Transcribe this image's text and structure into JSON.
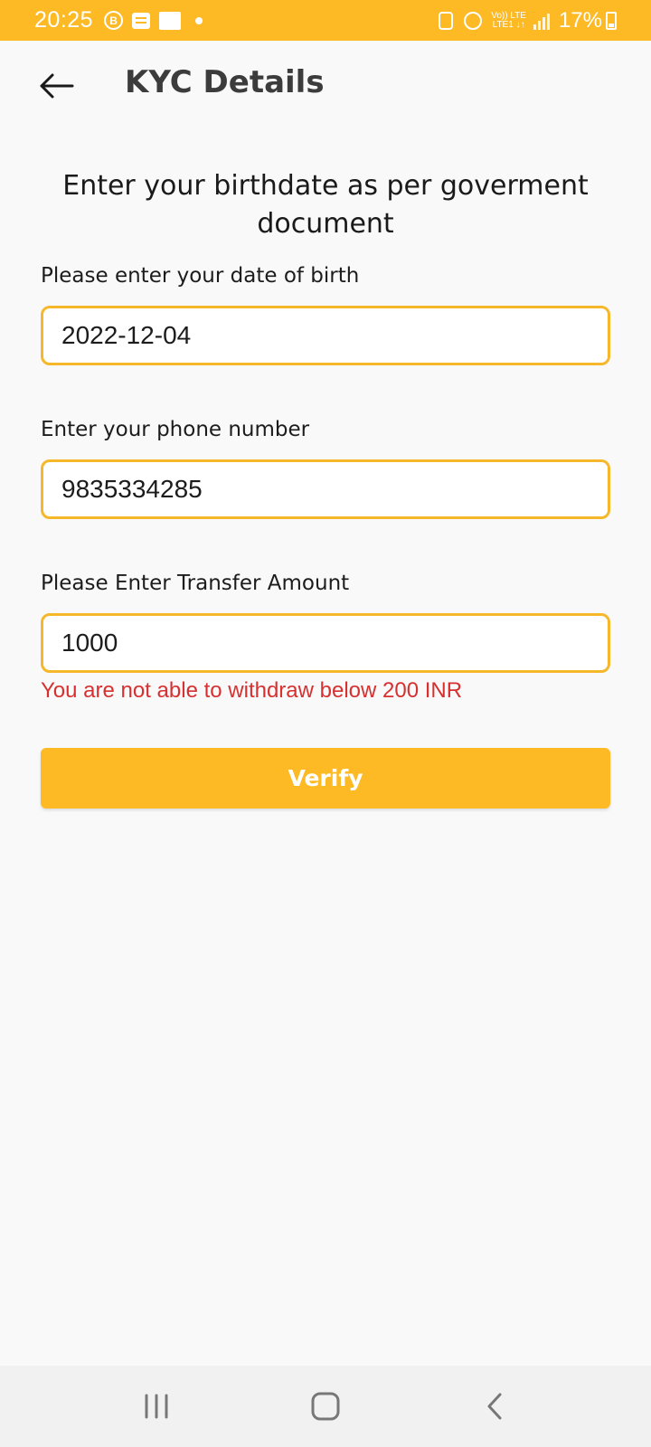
{
  "status_bar": {
    "time": "20:25",
    "network_top": "Vo)) LTE",
    "network_bottom": "LTE1 ↓↑",
    "battery": "17%",
    "icons": [
      "b-circle-icon",
      "message-icon",
      "paytm-icon",
      "dot-icon",
      "lock-icon",
      "alarm-icon",
      "signal-icon",
      "battery-icon"
    ],
    "background": "#fdba24"
  },
  "app_bar": {
    "title": "KYC Details",
    "back_icon": "arrow-left-icon"
  },
  "form": {
    "heading": "Enter your birthdate as per goverment document",
    "dob": {
      "label": "Please enter your date of birth",
      "value": "2022-12-04"
    },
    "phone": {
      "label": "Enter your phone number",
      "value": "9835334285"
    },
    "amount": {
      "label": "Please Enter Transfer Amount",
      "value": "1000",
      "error": "You are not able to withdraw below 200 INR"
    },
    "verify_label": "Verify"
  },
  "colors": {
    "accent": "#fdba24",
    "input_border": "#f6b82a",
    "error": "#d63030"
  },
  "nav_bar": {
    "icons": [
      "recent-apps-icon",
      "home-icon",
      "back-icon"
    ]
  }
}
